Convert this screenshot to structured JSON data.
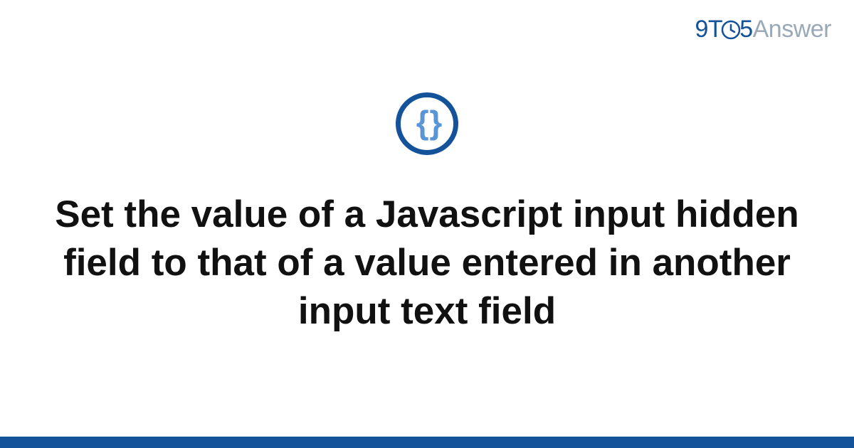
{
  "logo": {
    "part1": "9T",
    "part2": "5",
    "part3": "Answer"
  },
  "icon": {
    "name": "braces-icon",
    "glyph": "{ }"
  },
  "title": "Set the value of a Javascript input hidden field to that of a value entered in another input text field",
  "colors": {
    "brand": "#14529a",
    "muted": "#9aa8b8",
    "brace": "#5a95d6"
  }
}
